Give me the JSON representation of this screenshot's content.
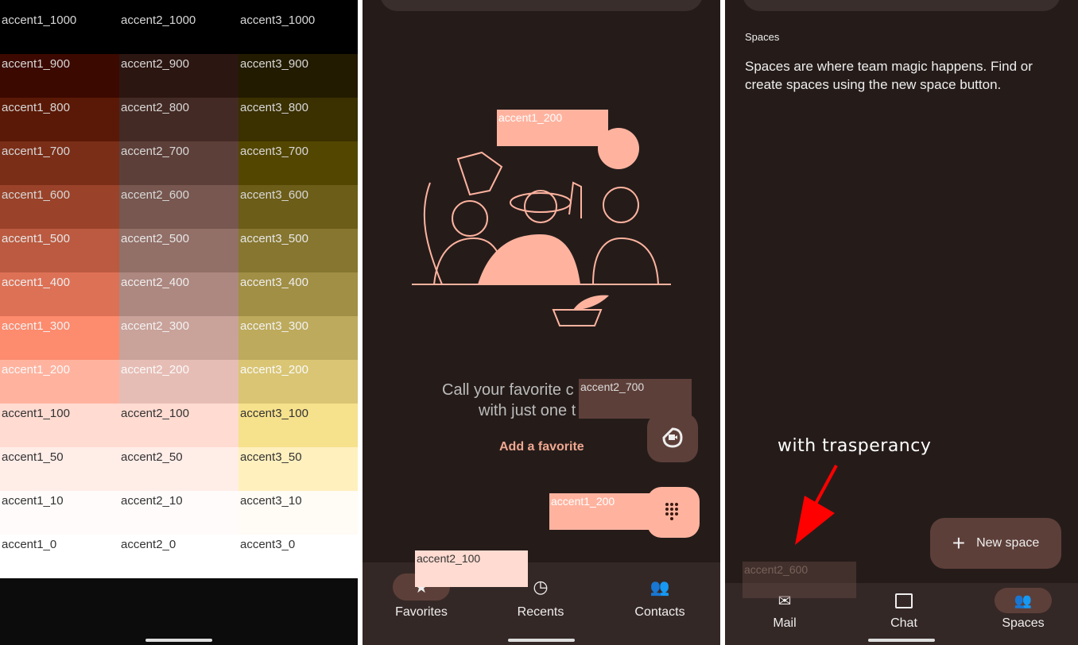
{
  "palette": {
    "rows": [
      [
        {
          "name": "accent1_1000",
          "color": "#000000",
          "text": "#d8d8d8"
        },
        {
          "name": "accent2_1000",
          "color": "#000000",
          "text": "#d8d8d8"
        },
        {
          "name": "accent3_1000",
          "color": "#000000",
          "text": "#d8d8d8"
        }
      ],
      [
        {
          "name": "accent1_900",
          "color": "#3b0900",
          "text": "#d8d8d8"
        },
        {
          "name": "accent2_900",
          "color": "#2c1611",
          "text": "#d8d8d8"
        },
        {
          "name": "accent3_900",
          "color": "#221b00",
          "text": "#d8d8d8"
        }
      ],
      [
        {
          "name": "accent1_800",
          "color": "#5a1906",
          "text": "#d8d8d8"
        },
        {
          "name": "accent2_800",
          "color": "#442a24",
          "text": "#d8d8d8"
        },
        {
          "name": "accent3_800",
          "color": "#3a3000",
          "text": "#d8d8d8"
        }
      ],
      [
        {
          "name": "accent1_700",
          "color": "#7a2e18",
          "text": "#d8d8d8"
        },
        {
          "name": "accent2_700",
          "color": "#5d3f39",
          "text": "#d8d8d8"
        },
        {
          "name": "accent3_700",
          "color": "#534600",
          "text": "#d8d8d8"
        }
      ],
      [
        {
          "name": "accent1_600",
          "color": "#9a432a",
          "text": "#d8d8d8"
        },
        {
          "name": "accent2_600",
          "color": "#77574f",
          "text": "#d8d8d8"
        },
        {
          "name": "accent3_600",
          "color": "#6c5d18",
          "text": "#d8d8d8"
        }
      ],
      [
        {
          "name": "accent1_500",
          "color": "#bb5a40",
          "text": "#e8e8e8"
        },
        {
          "name": "accent2_500",
          "color": "#926f67",
          "text": "#e8e8e8"
        },
        {
          "name": "accent3_500",
          "color": "#86762f",
          "text": "#e8e8e8"
        }
      ],
      [
        {
          "name": "accent1_400",
          "color": "#dd7156",
          "text": "#eeeeee"
        },
        {
          "name": "accent2_400",
          "color": "#ad8880",
          "text": "#eeeeee"
        },
        {
          "name": "accent3_400",
          "color": "#a18f45",
          "text": "#eeeeee"
        }
      ],
      [
        {
          "name": "accent1_300",
          "color": "#fd8b6e",
          "text": "#f2f2f2"
        },
        {
          "name": "accent2_300",
          "color": "#c9a29a",
          "text": "#f2f2f2"
        },
        {
          "name": "accent3_300",
          "color": "#bdaa5c",
          "text": "#f2f2f2"
        }
      ],
      [
        {
          "name": "accent1_200",
          "color": "#ffb39f",
          "text": "#fafafa"
        },
        {
          "name": "accent2_200",
          "color": "#e6bdb5",
          "text": "#fafafa"
        },
        {
          "name": "accent3_200",
          "color": "#d9c574",
          "text": "#fafafa"
        }
      ],
      [
        {
          "name": "accent1_100",
          "color": "#ffdbd1",
          "text": "#333333"
        },
        {
          "name": "accent2_100",
          "color": "#ffdbd1",
          "text": "#333333"
        },
        {
          "name": "accent3_100",
          "color": "#f6e18c",
          "text": "#333333"
        }
      ],
      [
        {
          "name": "accent1_50",
          "color": "#ffede8",
          "text": "#333333"
        },
        {
          "name": "accent2_50",
          "color": "#ffede8",
          "text": "#333333"
        },
        {
          "name": "accent3_50",
          "color": "#fff0be",
          "text": "#333333"
        }
      ],
      [
        {
          "name": "accent1_10",
          "color": "#fffbfa",
          "text": "#333333"
        },
        {
          "name": "accent2_10",
          "color": "#fffbfa",
          "text": "#333333"
        },
        {
          "name": "accent3_10",
          "color": "#fffbf5",
          "text": "#333333"
        }
      ],
      [
        {
          "name": "accent1_0",
          "color": "#ffffff",
          "text": "#333333"
        },
        {
          "name": "accent2_0",
          "color": "#ffffff",
          "text": "#333333"
        },
        {
          "name": "accent3_0",
          "color": "#ffffff",
          "text": "#333333"
        }
      ]
    ]
  },
  "dialer": {
    "overlay_top": "accent1_200",
    "empty_line1": "Call your favorite c",
    "empty_line2": "with just one t",
    "overlay_mid": "accent2_700",
    "add_favorite": "Add a favorite",
    "overlay_dial": "accent1_200",
    "overlay_nav": "accent2_100",
    "nav": [
      {
        "label": "Favorites",
        "icon": "star-icon"
      },
      {
        "label": "Recents",
        "icon": "clock-icon"
      },
      {
        "label": "Contacts",
        "icon": "contacts-icon"
      }
    ]
  },
  "gmail": {
    "section_title": "Spaces",
    "description": "Spaces are where team magic happens. Find or create spaces using the new space button.",
    "annotation": "with trasperancy",
    "overlay_nav": "accent2_600",
    "new_space": "New space",
    "nav": [
      {
        "label": "Mail",
        "icon": "mail-icon"
      },
      {
        "label": "Chat",
        "icon": "chat-icon"
      },
      {
        "label": "Spaces",
        "icon": "spaces-icon"
      }
    ]
  },
  "colors": {
    "accent1_200": "#ffb39f",
    "accent2_700": "#5d3f39",
    "accent2_100": "#ffdbd1",
    "accent2_600": "#77574f",
    "arrow": "#ff0000"
  }
}
